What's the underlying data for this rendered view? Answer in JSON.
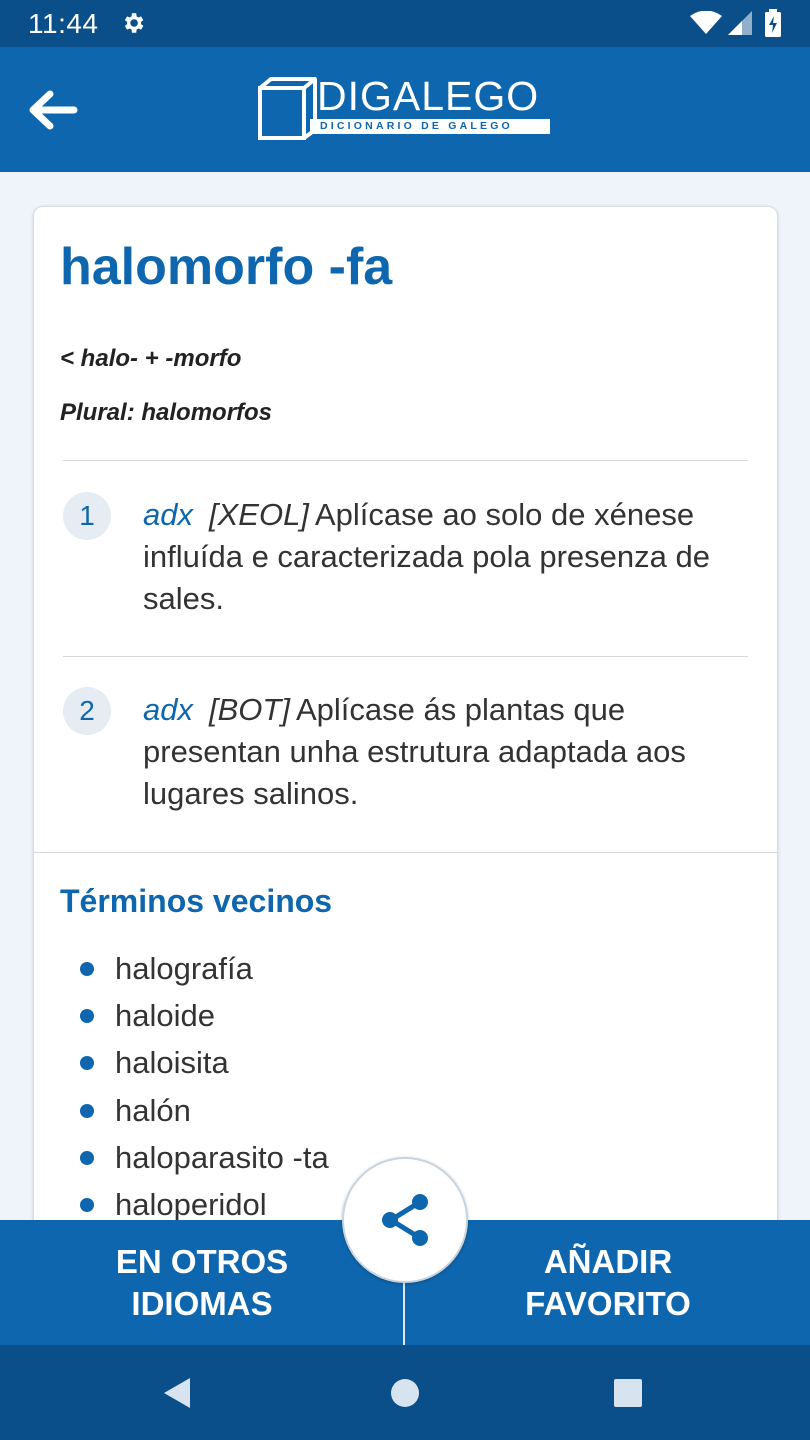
{
  "status_bar": {
    "time": "11:44"
  },
  "header": {
    "logo_title": "DIGALEGO",
    "logo_subtitle": "DICIONARIO DE GALEGO"
  },
  "entry": {
    "headword": "halomorfo -fa",
    "etymology": "< halo- + -morfo",
    "plural": "Plural: halomorfos",
    "senses": [
      {
        "number": "1",
        "pos": "adx",
        "area": "[XEOL]",
        "definition": "Aplícase ao solo de xénese influída e caracterizada pola presenza de sales."
      },
      {
        "number": "2",
        "pos": "adx",
        "area": "[BOT]",
        "definition": "Aplícase ás plantas que presentan unha estrutura adaptada aos lugares salinos."
      }
    ]
  },
  "neighbors": {
    "title": "Términos vecinos",
    "items": [
      "halografía",
      "haloide",
      "haloisita",
      "halón",
      "haloparasito -ta",
      "haloperidol"
    ]
  },
  "actions": {
    "other_languages_line1": "EN OTROS",
    "other_languages_line2": "IDIOMAS",
    "add_favorite_line1": "AÑADIR",
    "add_favorite_line2": "FAVORITO"
  },
  "colors": {
    "primary": "#0e67ae",
    "status_bar": "#0a4f8a",
    "background": "#eef4fa"
  },
  "icons": {
    "back": "arrow-left-icon",
    "share": "share-icon",
    "settings": "gear-icon"
  }
}
